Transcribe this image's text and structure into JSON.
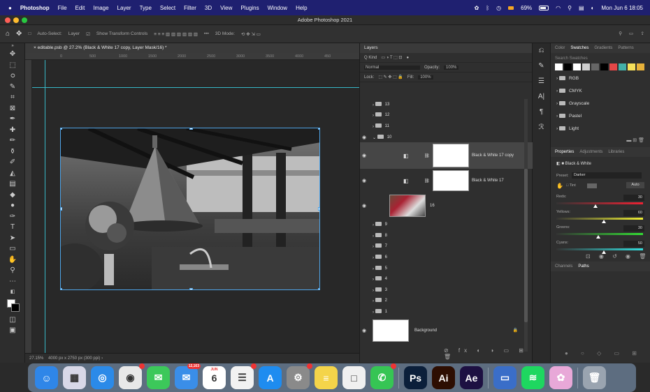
{
  "menubar": {
    "app": "Photoshop",
    "items": [
      "File",
      "Edit",
      "Image",
      "Layer",
      "Type",
      "Select",
      "Filter",
      "3D",
      "View",
      "Plugins",
      "Window",
      "Help"
    ],
    "battery": "69%",
    "datetime": "Mon Jun 6 18:05"
  },
  "window": {
    "title": "Adobe Photoshop 2021"
  },
  "options": {
    "auto_select": "Auto-Select:",
    "layer": "Layer",
    "show_transform": "Show Transform Controls",
    "mode_3d": "3D Mode:"
  },
  "document": {
    "tab": "editable.psb @ 27.2% (Black & White 17 copy, Layer Mask/16) *",
    "ruler": [
      "0",
      "500",
      "1000",
      "1500",
      "2000",
      "2500",
      "3000",
      "3500",
      "4000",
      "450"
    ],
    "zoom": "27.15%",
    "info": "4000 px x 2750 px (300 ppi)"
  },
  "layers_panel": {
    "title": "Layers",
    "kind": "Q Kind",
    "blend": "Normal",
    "opacity_label": "Opacity:",
    "opacity": "100%",
    "lock_label": "Lock:",
    "fill_label": "Fill:",
    "fill": "100%",
    "rows": [
      {
        "name": "13",
        "type": "group"
      },
      {
        "name": "12",
        "type": "group"
      },
      {
        "name": "11",
        "type": "group"
      },
      {
        "name": "10",
        "type": "group-open"
      },
      {
        "name": "Black & White 17 copy",
        "type": "adj-selected"
      },
      {
        "name": "Black & White 17",
        "type": "adj"
      },
      {
        "name": "16",
        "type": "image"
      },
      {
        "name": "9",
        "type": "group"
      },
      {
        "name": "8",
        "type": "group"
      },
      {
        "name": "7",
        "type": "group"
      },
      {
        "name": "6",
        "type": "group"
      },
      {
        "name": "5",
        "type": "group"
      },
      {
        "name": "4",
        "type": "group"
      },
      {
        "name": "3",
        "type": "group"
      },
      {
        "name": "2",
        "type": "group"
      },
      {
        "name": "1",
        "type": "group"
      },
      {
        "name": "Background",
        "type": "background"
      }
    ]
  },
  "swatches": {
    "tabs": [
      "Color",
      "Swatches",
      "Gradients",
      "Patterns"
    ],
    "active": "Swatches",
    "search": "Search Swatches",
    "colors": [
      "#ffffff",
      "#000000",
      "#ffffff",
      "#cccccc",
      "#666666",
      "#000000",
      "#e34747",
      "#44b0a8",
      "#f6e05a",
      "#e8b23a"
    ],
    "groups": [
      "RGB",
      "CMYK",
      "Grayscale",
      "Pastel",
      "Light"
    ]
  },
  "properties": {
    "tabs": [
      "Properties",
      "Adjustments",
      "Libraries"
    ],
    "active": "Properties",
    "adjustment": "Black & White",
    "preset_label": "Preset:",
    "preset": "Darker",
    "tint": "Tint",
    "auto": "Auto",
    "sliders": [
      {
        "label": "Reds:",
        "value": "30",
        "pos": 0.45
      },
      {
        "label": "Yellows:",
        "value": "60",
        "pos": 0.55
      },
      {
        "label": "Greens:",
        "value": "30",
        "pos": 0.48
      },
      {
        "label": "Cyans:",
        "value": "50",
        "pos": 0.55
      }
    ]
  },
  "channels": {
    "tabs": [
      "Channels",
      "Paths"
    ],
    "active": "Paths"
  },
  "dock": [
    {
      "name": "finder",
      "glyph": "☺",
      "color": "#2f86e8"
    },
    {
      "name": "launchpad",
      "glyph": "▦",
      "color": "#d8d8e8"
    },
    {
      "name": "safari",
      "glyph": "◎",
      "color": "#2b8ae8"
    },
    {
      "name": "chrome",
      "glyph": "◉",
      "color": "#e8e8e8",
      "badge": ""
    },
    {
      "name": "messages",
      "glyph": "✉",
      "color": "#3cc85a"
    },
    {
      "name": "mail",
      "glyph": "✉",
      "color": "#3a8ee8",
      "badge": "12,163"
    },
    {
      "name": "calendar",
      "glyph": "6",
      "color": "#ffffff",
      "label_top": "JUN"
    },
    {
      "name": "reminders",
      "glyph": "☰",
      "color": "#f2f2f2",
      "badge": ""
    },
    {
      "name": "app-store",
      "glyph": "A",
      "color": "#1e8cf0"
    },
    {
      "name": "system-preferences",
      "glyph": "⚙",
      "color": "#8a8a8a",
      "badge": ""
    },
    {
      "name": "notes",
      "glyph": "≡",
      "color": "#f4d44a"
    },
    {
      "name": "stickies",
      "glyph": "□",
      "color": "#f0f0f0"
    },
    {
      "name": "whatsapp",
      "glyph": "✆",
      "color": "#36c554",
      "badge": ""
    },
    {
      "name": "photoshop",
      "glyph": "Ps",
      "color": "#0b1f3a"
    },
    {
      "name": "illustrator",
      "glyph": "Ai",
      "color": "#2d0e02"
    },
    {
      "name": "after-effects",
      "glyph": "Ae",
      "color": "#1d1042"
    },
    {
      "name": "preview",
      "glyph": "▭",
      "color": "#3a6ec8"
    },
    {
      "name": "spotify",
      "glyph": "≋",
      "color": "#1ed760"
    },
    {
      "name": "photos-app",
      "glyph": "✿",
      "color": "#e8a8d8"
    },
    {
      "name": "trash",
      "glyph": "🗑",
      "color": "#9aa4b0"
    }
  ]
}
